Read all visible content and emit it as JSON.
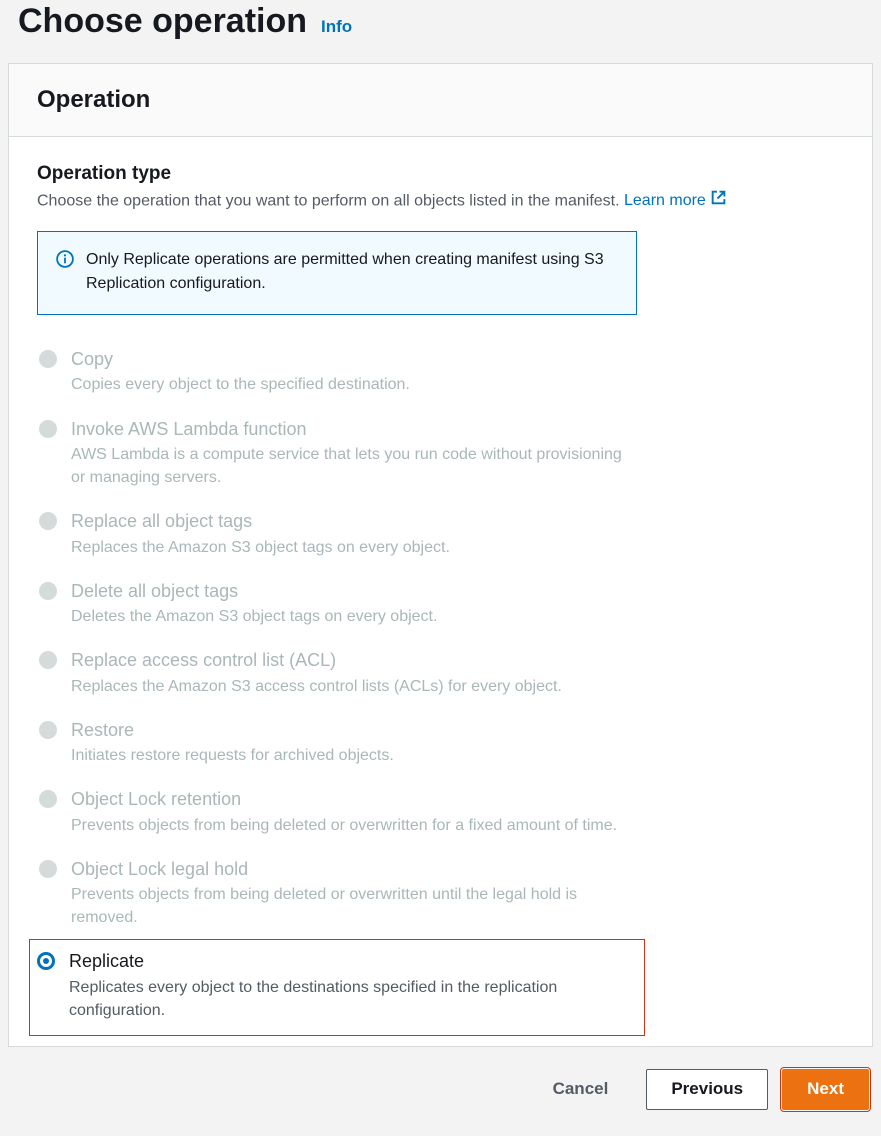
{
  "header": {
    "title": "Choose operation",
    "info_label": "Info"
  },
  "panel": {
    "title": "Operation"
  },
  "section": {
    "title": "Operation type",
    "desc_prefix": "Choose the operation that you want to perform on all objects listed in the manifest. ",
    "learn_more": "Learn more"
  },
  "info_box": {
    "text": "Only Replicate operations are permitted when creating manifest using S3 Replication configuration."
  },
  "operations": [
    {
      "id": "copy",
      "title": "Copy",
      "desc": "Copies every object to the specified destination.",
      "disabled": true,
      "selected": false
    },
    {
      "id": "lambda",
      "title": "Invoke AWS Lambda function",
      "desc": "AWS Lambda is a compute service that lets you run code without provisioning or managing servers.",
      "disabled": true,
      "selected": false
    },
    {
      "id": "replace-tags",
      "title": "Replace all object tags",
      "desc": "Replaces the Amazon S3 object tags on every object.",
      "disabled": true,
      "selected": false
    },
    {
      "id": "delete-tags",
      "title": "Delete all object tags",
      "desc": "Deletes the Amazon S3 object tags on every object.",
      "disabled": true,
      "selected": false
    },
    {
      "id": "replace-acl",
      "title": "Replace access control list (ACL)",
      "desc": "Replaces the Amazon S3 access control lists (ACLs) for every object.",
      "disabled": true,
      "selected": false
    },
    {
      "id": "restore",
      "title": "Restore",
      "desc": "Initiates restore requests for archived objects.",
      "disabled": true,
      "selected": false
    },
    {
      "id": "lock-retention",
      "title": "Object Lock retention",
      "desc": "Prevents objects from being deleted or overwritten for a fixed amount of time.",
      "disabled": true,
      "selected": false
    },
    {
      "id": "lock-legal-hold",
      "title": "Object Lock legal hold",
      "desc": "Prevents objects from being deleted or overwritten until the legal hold is removed.",
      "disabled": true,
      "selected": false
    },
    {
      "id": "replicate",
      "title": "Replicate",
      "desc": "Replicates every object to the destinations specified in the replication configuration.",
      "disabled": false,
      "selected": true
    }
  ],
  "buttons": {
    "cancel": "Cancel",
    "previous": "Previous",
    "next": "Next"
  }
}
